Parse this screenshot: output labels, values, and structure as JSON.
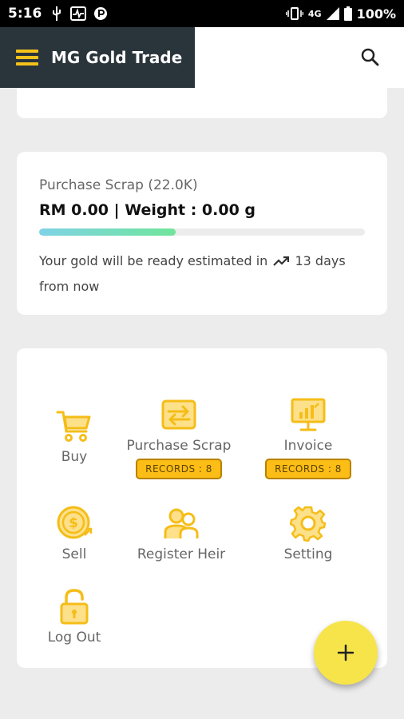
{
  "status_bar": {
    "time": "5:16",
    "network": "4G",
    "battery": "100%",
    "icons_left": [
      "usb-icon",
      "pulse-icon",
      "p-icon"
    ],
    "icons_right": [
      "vibrate-icon",
      "signal-icon",
      "battery-icon"
    ]
  },
  "app_bar": {
    "title": "MG Gold Trade",
    "menu_icon": "hamburger-icon",
    "search_icon": "search-icon"
  },
  "purchase_scrap": {
    "title": "Purchase Scrap (22.0K)",
    "amount_line": "RM 0.00 | Weight : 0.00 g",
    "progress_fraction": 0.42,
    "note_before": "Your gold will be ready estimated in",
    "note_after": "13 days from now",
    "trend_icon": "trending-up-icon"
  },
  "menu": {
    "items": [
      {
        "label": "Buy",
        "icon": "cart-icon"
      },
      {
        "label": "Purchase Scrap",
        "icon": "exchange-icon",
        "badge": "RECORDS : 8"
      },
      {
        "label": "Invoice",
        "icon": "monitor-chart-icon",
        "badge": "RECORDS : 8"
      },
      {
        "label": "Sell",
        "icon": "coin-dollar-icon"
      },
      {
        "label": "Register Heir",
        "icon": "heir-icon"
      },
      {
        "label": "Setting",
        "icon": "gear-icon"
      },
      {
        "label": "Log Out",
        "icon": "padlock-icon"
      }
    ]
  },
  "fab": {
    "icon": "plus-icon"
  },
  "colors": {
    "accent": "#fbbd16",
    "app_bar_dark": "#2a343b",
    "fab": "#f7e44a",
    "background": "#ececec"
  }
}
